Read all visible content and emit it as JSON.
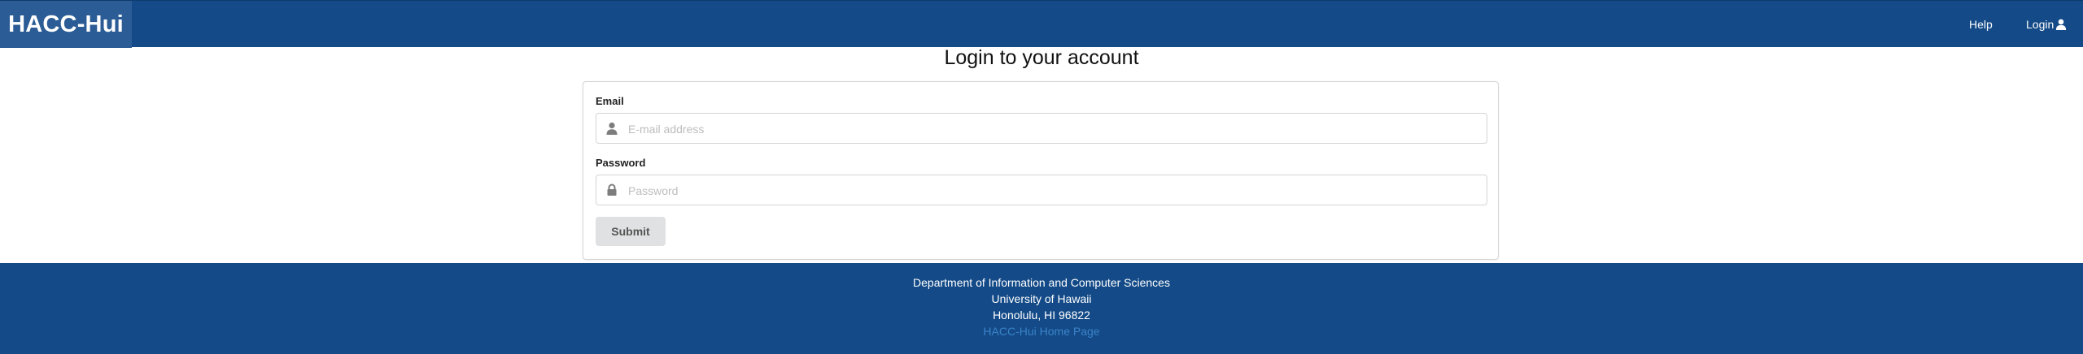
{
  "navbar": {
    "brand": "HACC-Hui",
    "help_label": "Help",
    "login_label": "Login",
    "login_icon": "user-icon"
  },
  "page": {
    "title": "Login to your account"
  },
  "form": {
    "email_label": "Email",
    "email_placeholder": "E-mail address",
    "email_value": "",
    "email_icon": "user-icon",
    "password_label": "Password",
    "password_placeholder": "Password",
    "password_value": "",
    "password_icon": "lock-icon",
    "submit_label": "Submit"
  },
  "footer": {
    "line1": "Department of Information and Computer Sciences",
    "line2": "University of Hawaii",
    "line3": "Honolulu, HI 96822",
    "link_label": "HACC-Hui Home Page"
  },
  "colors": {
    "navbar_bg": "#134a87",
    "brand_bg": "#2b5c95",
    "footer_link": "#3b83c9",
    "submit_bg": "#e0e1e2"
  }
}
